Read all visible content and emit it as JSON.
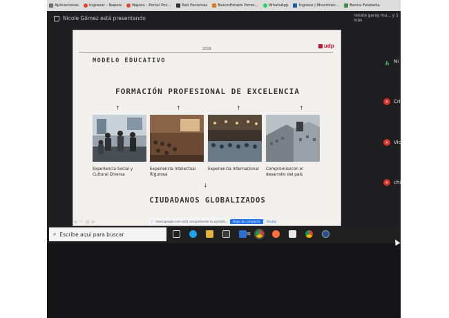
{
  "bookmarks": {
    "items": [
      {
        "label": "Aplicaciones",
        "color": "#6d6d6d"
      },
      {
        "label": "Ingresar - Napsis",
        "color": "#e04b2a"
      },
      {
        "label": "Napsis - Portal Poc...",
        "color": "#e04b2a"
      },
      {
        "label": "Rali Personas",
        "color": "#333333"
      },
      {
        "label": "BancoEstado Perso...",
        "color": "#e07a1f"
      },
      {
        "label": "WhatsApp",
        "color": "#25d366"
      },
      {
        "label": "Ingreso | Movimien...",
        "color": "#1b5fa8"
      },
      {
        "label": "Banco Falabella",
        "color": "#3a8d3a"
      }
    ]
  },
  "meet": {
    "presenting_text": "Nicole Gómez está presentando",
    "remote_name": "renate garay mu... y 1 más",
    "participants": [
      {
        "label": "Ni",
        "mic": "speaking"
      },
      {
        "label": "Cri",
        "mic": "muted"
      },
      {
        "label": "Vic",
        "mic": "muted"
      },
      {
        "label": "chi",
        "mic": "muted"
      }
    ]
  },
  "slide": {
    "year": "2019",
    "logo": "udp",
    "title": "MODELO EDUCATIVO",
    "heading": "FORMACIÓN PROFESIONAL DE EXCELENCIA",
    "arrow_up": "↑",
    "pillars": [
      {
        "caption": "Experiencia Social y Cultural Diversa"
      },
      {
        "caption": "Experiencia Intelectual Rigurosa"
      },
      {
        "caption": "Experiencia Internacional"
      },
      {
        "caption": "Compromisocon el desarrollo del país"
      }
    ],
    "arrow_down": "↓",
    "footer": "CIUDADANOS GLOBALIZADOS"
  },
  "share_bar": {
    "message": "meet.google.com está compartiendo tu pantalla.",
    "stop_label": "Dejar de compartir",
    "hide_label": "Ocultar"
  },
  "taskbar": {
    "search_placeholder": "Escribe aquí para buscar",
    "mail_badge": "91"
  },
  "accent": {
    "meet_red": "#d93025",
    "udp_red": "#c8102e",
    "windows_blue": "#1a73e8"
  }
}
